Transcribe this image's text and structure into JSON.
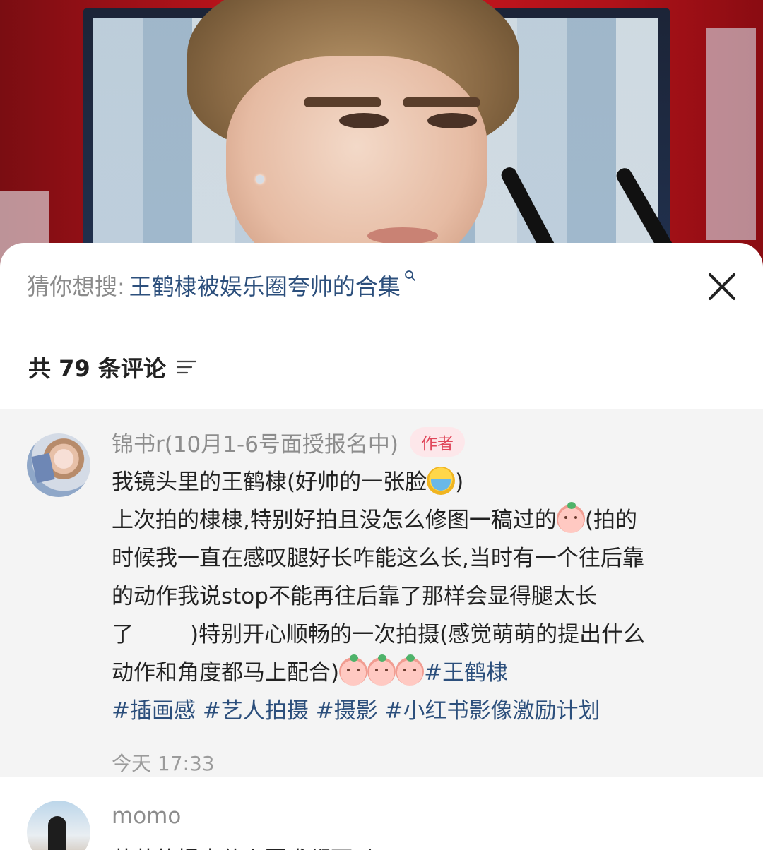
{
  "suggest": {
    "prefix": "猜你想搜:",
    "term": "王鹤棣被娱乐圈夸帅的合集"
  },
  "comments_header": {
    "count_label": "共 79 条评论"
  },
  "comment": {
    "username": "锦书r(10月1-6号面授报名中)",
    "badge": "作者",
    "line1": "我镜头里的王鹤棣(好帅的一张脸",
    "line1_end": ")",
    "line2": "上次拍的棣棣,特别好拍且没怎么修图一稿过的",
    "line2_end": "(拍的",
    "line3": "时候我一直在感叹腿好长咋能这么长,当时有一个往后靠",
    "line4": "的动作我说stop不能再往后靠了那样会显得腿太长",
    "line5_a": "了",
    "line5_b": ")特别开心顺畅的一次拍摄(感觉萌萌的提出什么",
    "line6": "动作和角度都马上配合)",
    "tags_inline": "#王鹤棣",
    "tags": [
      "#插画感",
      "#艺人拍摄",
      "#摄影",
      "#小红书影像激励计划"
    ],
    "time": "今天 17:33",
    "icons": {
      "emoji1": "loudly-crying-emoji",
      "emoji2": "crying-peach-emoji",
      "emoji3": "peach-emoji"
    }
  },
  "next_comment": {
    "username": "momo",
    "preview": "萌萌的提出什么要求都可以"
  },
  "colors": {
    "link": "#2c4f7c",
    "badge_bg": "#fde7ea",
    "badge_text": "#e0475a",
    "card_bg": "#f4f4f4"
  }
}
